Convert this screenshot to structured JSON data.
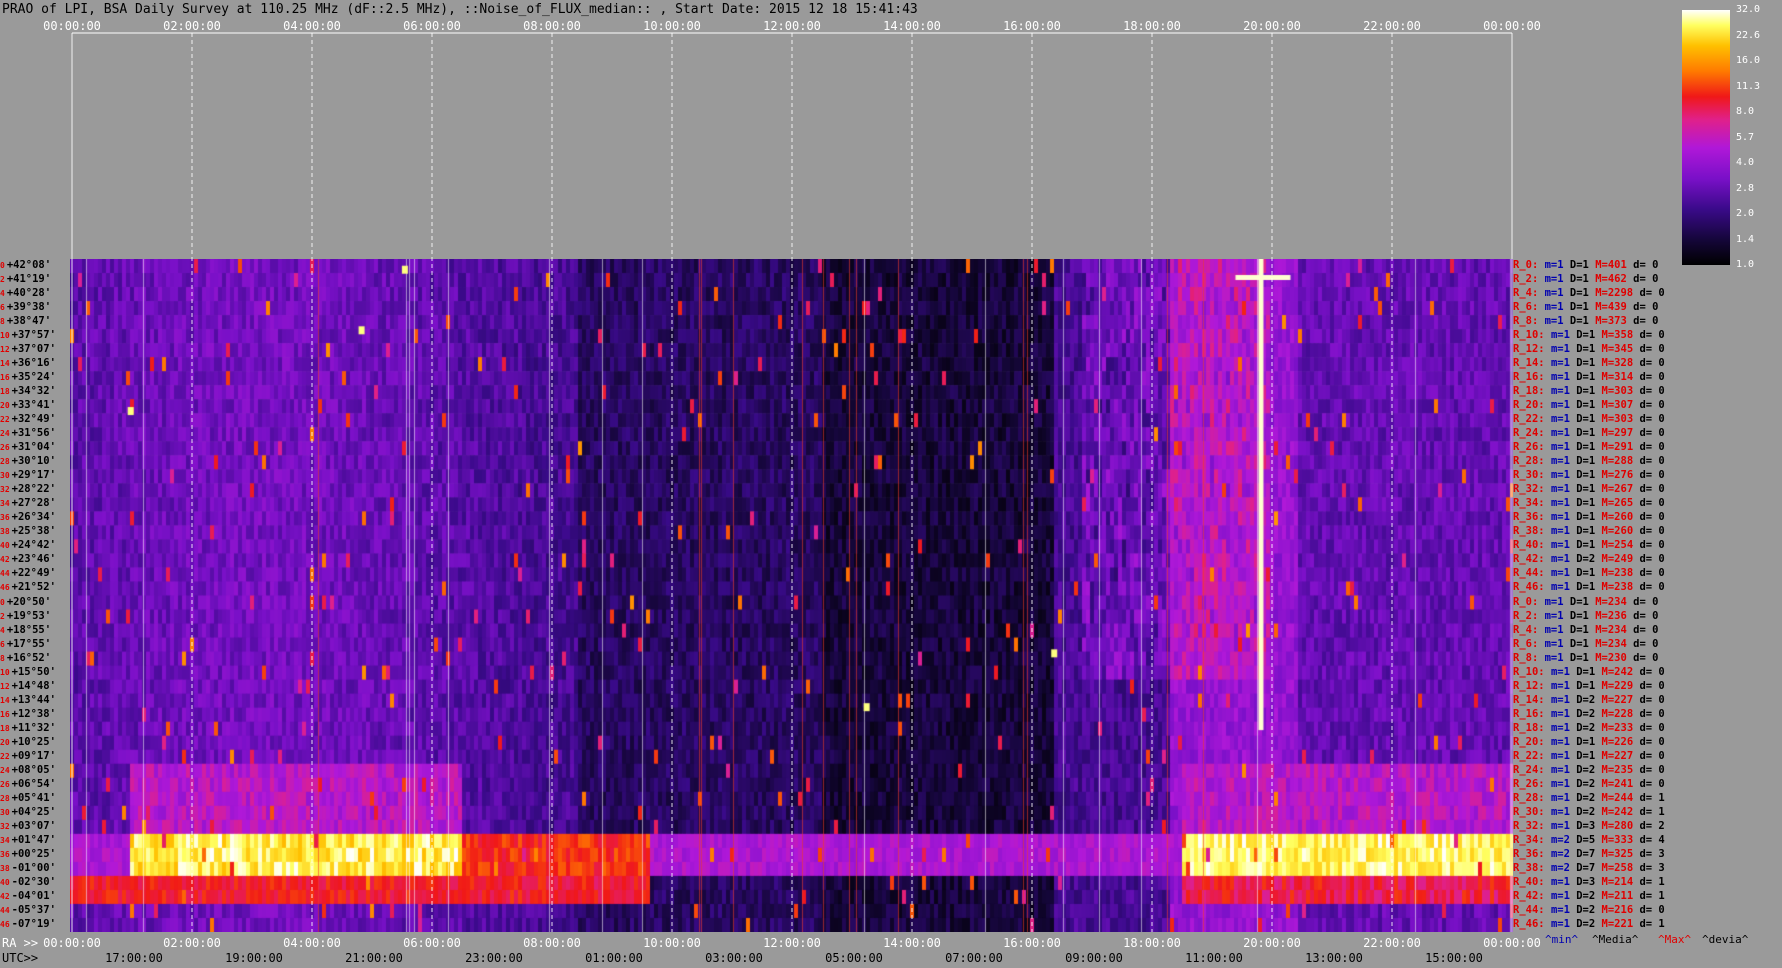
{
  "title": "PRAO of LPI, BSA Daily Survey at 110.25 MHz (dF::2.5 MHz), ::Noise_of_FLUX_median:: , Start Date: 2015 12 18 15:41:43",
  "colors": {
    "background": "#9a9a9a",
    "stats_red": "#e00000",
    "stats_blue": "#0000b0"
  },
  "chart_data": {
    "type": "heatmap",
    "title": "PRAO of LPI, BSA Daily Survey at 110.25 MHz (dF::2.5 MHz), ::Noise_of_FLUX_median:: , Start Date: 2015 12 18 15:41:43",
    "top_ticks": [
      "00:00:00",
      "02:00:00",
      "04:00:00",
      "06:00:00",
      "08:00:00",
      "10:00:00",
      "12:00:00",
      "14:00:00",
      "16:00:00",
      "18:00:00",
      "20:00:00",
      "22:00:00",
      "00:00:00"
    ],
    "ra_label": "RA >>",
    "ra_ticks": [
      "00:00:00",
      "02:00:00",
      "04:00:00",
      "06:00:00",
      "08:00:00",
      "10:00:00",
      "12:00:00",
      "14:00:00",
      "16:00:00",
      "18:00:00",
      "20:00:00",
      "22:00:00",
      "00:00:00"
    ],
    "utc_label": "UTC>>",
    "utc_ticks": [
      "17:00:00",
      "19:00:00",
      "21:00:00",
      "23:00:00",
      "01:00:00",
      "03:00:00",
      "05:00:00",
      "07:00:00",
      "09:00:00",
      "11:00:00",
      "13:00:00",
      "15:00:00"
    ],
    "colorbar": {
      "ticks": [
        "32.0",
        "22.6",
        "16.0",
        "11.3",
        "8.0",
        "5.7",
        "4.0",
        "2.8",
        "2.0",
        "1.4",
        "1.0"
      ],
      "range": [
        1.0,
        32.0
      ]
    },
    "declinations": [
      {
        "idx": "0",
        "dec": "+42°08'"
      },
      {
        "idx": "2",
        "dec": "+41°19'"
      },
      {
        "idx": "4",
        "dec": "+40°28'"
      },
      {
        "idx": "6",
        "dec": "+39°38'"
      },
      {
        "idx": "8",
        "dec": "+38°47'"
      },
      {
        "idx": "10",
        "dec": "+37°57'"
      },
      {
        "idx": "12",
        "dec": "+37°07'"
      },
      {
        "idx": "14",
        "dec": "+36°16'"
      },
      {
        "idx": "16",
        "dec": "+35°24'"
      },
      {
        "idx": "18",
        "dec": "+34°32'"
      },
      {
        "idx": "20",
        "dec": "+33°41'"
      },
      {
        "idx": "22",
        "dec": "+32°49'"
      },
      {
        "idx": "24",
        "dec": "+31°56'"
      },
      {
        "idx": "26",
        "dec": "+31°04'"
      },
      {
        "idx": "28",
        "dec": "+30°10'"
      },
      {
        "idx": "30",
        "dec": "+29°17'"
      },
      {
        "idx": "32",
        "dec": "+28°22'"
      },
      {
        "idx": "34",
        "dec": "+27°28'"
      },
      {
        "idx": "36",
        "dec": "+26°34'"
      },
      {
        "idx": "38",
        "dec": "+25°38'"
      },
      {
        "idx": "40",
        "dec": "+24°42'"
      },
      {
        "idx": "42",
        "dec": "+23°46'"
      },
      {
        "idx": "44",
        "dec": "+22°49'"
      },
      {
        "idx": "46",
        "dec": "+21°52'"
      },
      {
        "idx": "0",
        "dec": "+20°50'"
      },
      {
        "idx": "2",
        "dec": "+19°53'"
      },
      {
        "idx": "4",
        "dec": "+18°55'"
      },
      {
        "idx": "6",
        "dec": "+17°55'"
      },
      {
        "idx": "8",
        "dec": "+16°52'"
      },
      {
        "idx": "10",
        "dec": "+15°50'"
      },
      {
        "idx": "12",
        "dec": "+14°48'"
      },
      {
        "idx": "14",
        "dec": "+13°44'"
      },
      {
        "idx": "16",
        "dec": "+12°38'"
      },
      {
        "idx": "18",
        "dec": "+11°32'"
      },
      {
        "idx": "20",
        "dec": "+10°25'"
      },
      {
        "idx": "22",
        "dec": "+09°17'"
      },
      {
        "idx": "24",
        "dec": "+08°05'"
      },
      {
        "idx": "26",
        "dec": "+06°54'"
      },
      {
        "idx": "28",
        "dec": "+05°41'"
      },
      {
        "idx": "30",
        "dec": "+04°25'"
      },
      {
        "idx": "32",
        "dec": "+03°07'"
      },
      {
        "idx": "34",
        "dec": "+01°47'"
      },
      {
        "idx": "36",
        "dec": "+00°25'"
      },
      {
        "idx": "38",
        "dec": "-01°00'"
      },
      {
        "idx": "40",
        "dec": "-02°30'"
      },
      {
        "idx": "42",
        "dec": "-04°01'"
      },
      {
        "idx": "44",
        "dec": "-05°37'"
      },
      {
        "idx": "46",
        "dec": "-07°19'"
      }
    ],
    "row_stats": [
      {
        "r": "R_0:",
        "m": "m=1",
        "d": "D=1",
        "mx": "M=401",
        "dv": "d= 0"
      },
      {
        "r": "R_2:",
        "m": "m=1",
        "d": "D=1",
        "mx": "M=462",
        "dv": "d= 0"
      },
      {
        "r": "R_4:",
        "m": "m=1",
        "d": "D=1",
        "mx": "M=2298",
        "dv": "d= 0"
      },
      {
        "r": "R_6:",
        "m": "m=1",
        "d": "D=1",
        "mx": "M=439",
        "dv": "d= 0"
      },
      {
        "r": "R_8:",
        "m": "m=1",
        "d": "D=1",
        "mx": "M=373",
        "dv": "d= 0"
      },
      {
        "r": "R_10:",
        "m": "m=1",
        "d": "D=1",
        "mx": "M=358",
        "dv": "d= 0"
      },
      {
        "r": "R_12:",
        "m": "m=1",
        "d": "D=1",
        "mx": "M=345",
        "dv": "d= 0"
      },
      {
        "r": "R_14:",
        "m": "m=1",
        "d": "D=1",
        "mx": "M=328",
        "dv": "d= 0"
      },
      {
        "r": "R_16:",
        "m": "m=1",
        "d": "D=1",
        "mx": "M=314",
        "dv": "d= 0"
      },
      {
        "r": "R_18:",
        "m": "m=1",
        "d": "D=1",
        "mx": "M=303",
        "dv": "d= 0"
      },
      {
        "r": "R_20:",
        "m": "m=1",
        "d": "D=1",
        "mx": "M=307",
        "dv": "d= 0"
      },
      {
        "r": "R_22:",
        "m": "m=1",
        "d": "D=1",
        "mx": "M=303",
        "dv": "d= 0"
      },
      {
        "r": "R_24:",
        "m": "m=1",
        "d": "D=1",
        "mx": "M=297",
        "dv": "d= 0"
      },
      {
        "r": "R_26:",
        "m": "m=1",
        "d": "D=1",
        "mx": "M=291",
        "dv": "d= 0"
      },
      {
        "r": "R_28:",
        "m": "m=1",
        "d": "D=1",
        "mx": "M=288",
        "dv": "d= 0"
      },
      {
        "r": "R_30:",
        "m": "m=1",
        "d": "D=1",
        "mx": "M=276",
        "dv": "d= 0"
      },
      {
        "r": "R_32:",
        "m": "m=1",
        "d": "D=1",
        "mx": "M=267",
        "dv": "d= 0"
      },
      {
        "r": "R_34:",
        "m": "m=1",
        "d": "D=1",
        "mx": "M=265",
        "dv": "d= 0"
      },
      {
        "r": "R_36:",
        "m": "m=1",
        "d": "D=1",
        "mx": "M=260",
        "dv": "d= 0"
      },
      {
        "r": "R_38:",
        "m": "m=1",
        "d": "D=1",
        "mx": "M=260",
        "dv": "d= 0"
      },
      {
        "r": "R_40:",
        "m": "m=1",
        "d": "D=1",
        "mx": "M=254",
        "dv": "d= 0"
      },
      {
        "r": "R_42:",
        "m": "m=1",
        "d": "D=2",
        "mx": "M=249",
        "dv": "d= 0"
      },
      {
        "r": "R_44:",
        "m": "m=1",
        "d": "D=1",
        "mx": "M=238",
        "dv": "d= 0"
      },
      {
        "r": "R_46:",
        "m": "m=1",
        "d": "D=1",
        "mx": "M=238",
        "dv": "d= 0"
      },
      {
        "r": "R_0:",
        "m": "m=1",
        "d": "D=1",
        "mx": "M=234",
        "dv": "d= 0"
      },
      {
        "r": "R_2:",
        "m": "m=1",
        "d": "D=1",
        "mx": "M=236",
        "dv": "d= 0"
      },
      {
        "r": "R_4:",
        "m": "m=1",
        "d": "D=1",
        "mx": "M=234",
        "dv": "d= 0"
      },
      {
        "r": "R_6:",
        "m": "m=1",
        "d": "D=1",
        "mx": "M=234",
        "dv": "d= 0"
      },
      {
        "r": "R_8:",
        "m": "m=1",
        "d": "D=1",
        "mx": "M=230",
        "dv": "d= 0"
      },
      {
        "r": "R_10:",
        "m": "m=1",
        "d": "D=1",
        "mx": "M=242",
        "dv": "d= 0"
      },
      {
        "r": "R_12:",
        "m": "m=1",
        "d": "D=1",
        "mx": "M=229",
        "dv": "d= 0"
      },
      {
        "r": "R_14:",
        "m": "m=1",
        "d": "D=2",
        "mx": "M=227",
        "dv": "d= 0"
      },
      {
        "r": "R_16:",
        "m": "m=1",
        "d": "D=2",
        "mx": "M=228",
        "dv": "d= 0"
      },
      {
        "r": "R_18:",
        "m": "m=1",
        "d": "D=2",
        "mx": "M=233",
        "dv": "d= 0"
      },
      {
        "r": "R_20:",
        "m": "m=1",
        "d": "D=1",
        "mx": "M=226",
        "dv": "d= 0"
      },
      {
        "r": "R_22:",
        "m": "m=1",
        "d": "D=1",
        "mx": "M=227",
        "dv": "d= 0"
      },
      {
        "r": "R_24:",
        "m": "m=1",
        "d": "D=2",
        "mx": "M=235",
        "dv": "d= 0"
      },
      {
        "r": "R_26:",
        "m": "m=1",
        "d": "D=2",
        "mx": "M=241",
        "dv": "d= 0"
      },
      {
        "r": "R_28:",
        "m": "m=1",
        "d": "D=2",
        "mx": "M=244",
        "dv": "d= 1"
      },
      {
        "r": "R_30:",
        "m": "m=1",
        "d": "D=2",
        "mx": "M=242",
        "dv": "d= 1"
      },
      {
        "r": "R_32:",
        "m": "m=1",
        "d": "D=3",
        "mx": "M=280",
        "dv": "d= 2"
      },
      {
        "r": "R_34:",
        "m": "m=2",
        "d": "D=5",
        "mx": "M=333",
        "dv": "d= 4"
      },
      {
        "r": "R_36:",
        "m": "m=2",
        "d": "D=7",
        "mx": "M=325",
        "dv": "d= 3"
      },
      {
        "r": "R_38:",
        "m": "m=2",
        "d": "D=7",
        "mx": "M=258",
        "dv": "d= 3"
      },
      {
        "r": "R_40:",
        "m": "m=1",
        "d": "D=3",
        "mx": "M=214",
        "dv": "d= 1"
      },
      {
        "r": "R_42:",
        "m": "m=1",
        "d": "D=2",
        "mx": "M=211",
        "dv": "d= 1"
      },
      {
        "r": "R_44:",
        "m": "m=1",
        "d": "D=2",
        "mx": "M=216",
        "dv": "d= 0"
      },
      {
        "r": "R_46:",
        "m": "m=1",
        "d": "D=2",
        "mx": "M=221",
        "dv": "d= 1"
      }
    ],
    "stats_legend": {
      "min": "^min^",
      "media": "^Media^",
      "max": "^Max^",
      "devia": "^devia^"
    }
  }
}
